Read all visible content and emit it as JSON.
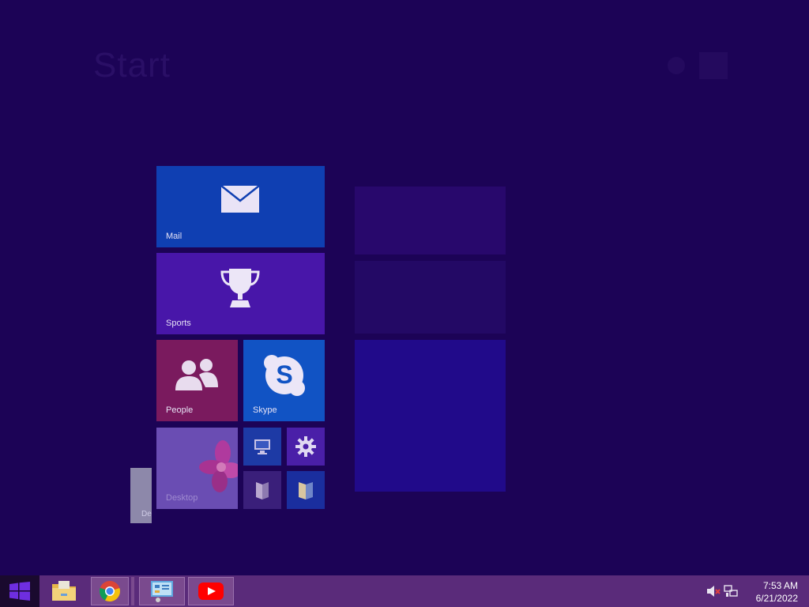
{
  "start": {
    "title": "Start"
  },
  "tiles": {
    "mail": "Mail",
    "sports": "Sports",
    "people": "People",
    "skype": "Skype",
    "desktop": "Desktop"
  },
  "ghost_labels": {
    "g1": "",
    "g2": "",
    "g3": ""
  },
  "drag_tile_label": "De",
  "colors": {
    "background": "#1c0356",
    "taskbar": "#5a2b7a",
    "mail": "#0f3fb2",
    "sports": "#4816a9",
    "people": "#7a1a5e",
    "skype": "#1153c4"
  },
  "taskbar": {
    "apps": [
      "file-explorer-icon",
      "chrome-icon",
      "control-panel-icon",
      "youtube-icon"
    ]
  },
  "clock": {
    "time": "7:53 AM",
    "date": "6/21/2022"
  }
}
